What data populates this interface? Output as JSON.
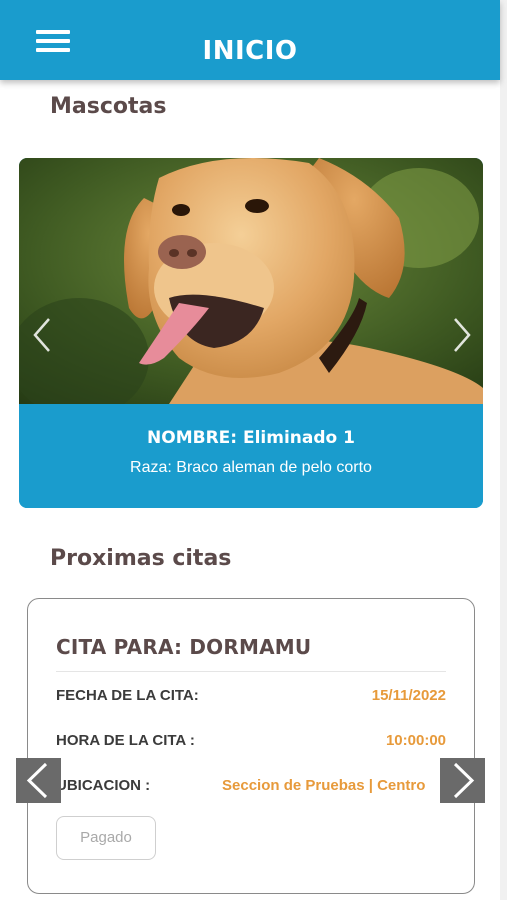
{
  "header": {
    "title": "INICIO"
  },
  "pets": {
    "section_title": "Mascotas",
    "current": {
      "name_line": "NOMBRE: Eliminado 1",
      "breed_line": "Raza: Braco aleman de pelo corto"
    }
  },
  "appointments": {
    "section_title": "Proximas citas",
    "current": {
      "title": "CITA PARA: DORMAMU",
      "date_label": "FECHA DE LA CITA:",
      "date_value": "15/11/2022",
      "time_label": "HORA DE LA CITA :",
      "time_value": "10:00:00",
      "location_label": "UBICACION :",
      "location_value": "Seccion de Pruebas | Centro",
      "status": "Pagado"
    }
  },
  "colors": {
    "primary": "#1a9ccd",
    "accent": "#e79a3b",
    "heading": "#5b4a4a"
  },
  "icons": [
    "menu-icon",
    "chevron-left-icon",
    "chevron-right-icon"
  ]
}
